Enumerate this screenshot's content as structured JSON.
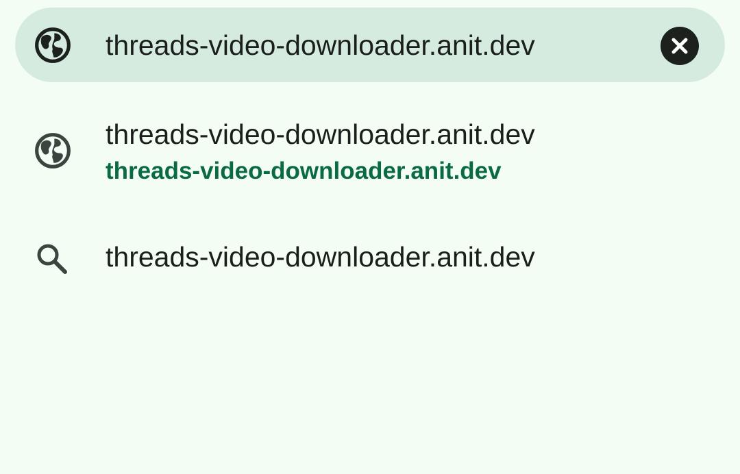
{
  "search_bar": {
    "value": "threads-video-downloader.anit.dev",
    "leading_icon": "globe-icon",
    "clear_icon": "close-icon"
  },
  "suggestions": [
    {
      "icon": "globe-icon",
      "title": "threads-video-downloader.anit.dev",
      "url": "threads-video-downloader.anit.dev"
    },
    {
      "icon": "search-icon",
      "title": "threads-video-downloader.anit.dev"
    }
  ],
  "colors": {
    "background": "#f3fdf3",
    "search_bar_bg": "#d5ebdf",
    "url_green": "#0a6b43",
    "text": "#1b1f1c"
  }
}
